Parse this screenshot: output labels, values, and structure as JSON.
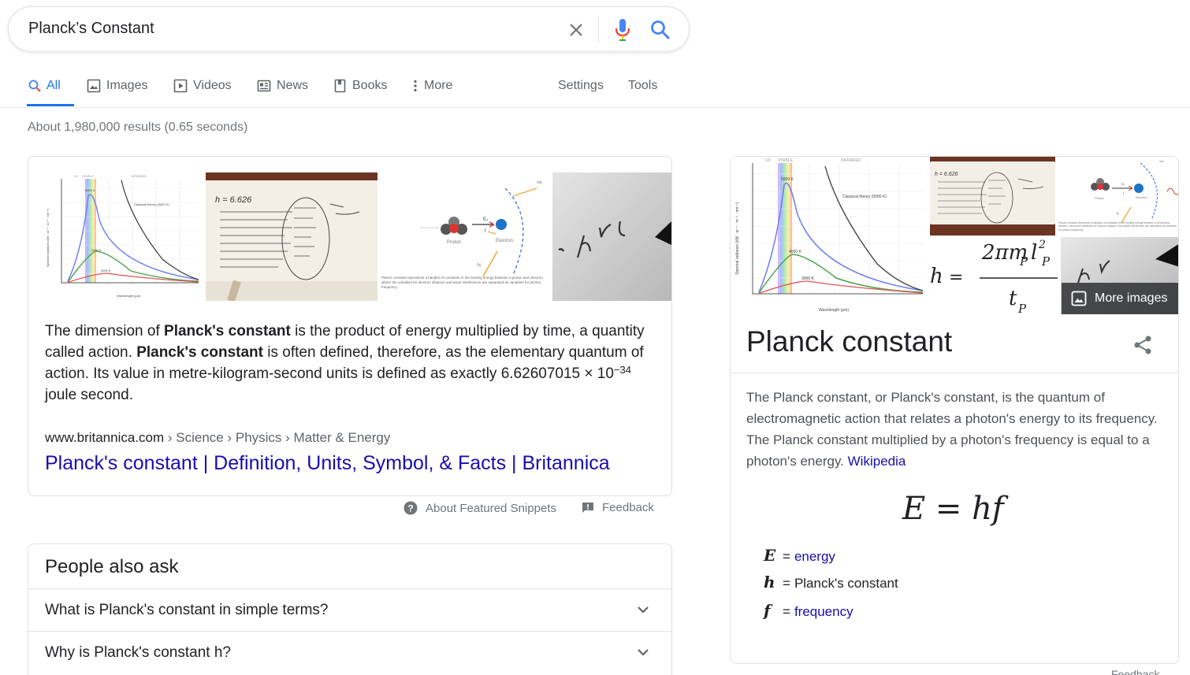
{
  "search": {
    "query": "Planck’s Constant",
    "icons": [
      "close-icon",
      "mic-icon",
      "search-icon"
    ]
  },
  "tabs": [
    {
      "label": "All",
      "icon": "search-icon",
      "active": true
    },
    {
      "label": "Images",
      "icon": "image-icon"
    },
    {
      "label": "Videos",
      "icon": "play-icon"
    },
    {
      "label": "News",
      "icon": "newspaper-icon"
    },
    {
      "label": "Books",
      "icon": "book-icon"
    },
    {
      "label": "More",
      "icon": "kebab-icon"
    }
  ],
  "tools": {
    "settings": "Settings",
    "tools": "Tools"
  },
  "stats": "About 1,980,000 results (0.65 seconds)",
  "snippet": {
    "thumb_text": {
      "curve_uv": "UV",
      "curve_visible": "VISIBLE",
      "curve_infrared": "INFRARED",
      "curve_classical": "Classical theory (5000 K)",
      "curve_5000": "5000 K",
      "curve_4000": "4000 K",
      "curve_3000": "3000 K",
      "curve_xlabel": "Wavelength (μm)",
      "curve_ylabel": "Spectral radiance (kW · sr⁻¹ · m⁻² · nm⁻¹)",
      "notes_h": "h = 6.626",
      "proton": "Proton",
      "electron": "Electron",
      "var": "var",
      "h": "h",
      "e2": "E₂",
      "f": "f",
      "diagram_caption": "Planck constant represents a handful of constants in the binding energy between a proton and electron, where the variables for electron distance and wave interference are separated as variables for photon frequency."
    },
    "text": {
      "p1": "The dimension of ",
      "b1": "Planck's constant",
      "p2": " is the product of energy multiplied by time, a quantity called action. ",
      "b2": "Planck's constant",
      "p3": " is often defined, therefore, as the elementary quantum of action. Its value in metre-kilogram-second units is defined as exactly 6.62607015 × 10",
      "exp": "−34",
      "p4": " joule second."
    },
    "cite_domain": "www.britannica.com",
    "cite_path": " › Science › Physics › Matter & Energy",
    "title": "Planck's constant | Definition, Units, Symbol, & Facts | Britannica",
    "about": "About Featured Snippets",
    "feedback": "Feedback"
  },
  "paa": {
    "title": "People also ask",
    "questions": [
      "What is Planck's constant in simple terms?",
      "Why is Planck's constant h?"
    ]
  },
  "knowledge_panel": {
    "more_images": "More images",
    "title": "Planck constant",
    "description": "The Planck constant, or Planck's constant, is the quantum of electromagnetic action that relates a photon's energy to its frequency. The Planck constant multiplied by a photon's frequency is equal to a photon's energy. ",
    "source": "Wikipedia",
    "formula": "E = hf",
    "image_formula": {
      "lhs": "h",
      "eq": "=",
      "num": "2πm",
      "sub": "P",
      "l": "l",
      "sup": "2",
      "den": "t"
    },
    "variables": [
      {
        "symbol": "E",
        "label": "energy",
        "link": true
      },
      {
        "symbol": "h",
        "label": "Planck's constant",
        "link": false
      },
      {
        "symbol": "f",
        "label": "frequency",
        "link": true
      }
    ],
    "feedback": "Feedback"
  },
  "colors": {
    "accent": "#1a73e8",
    "link": "#1a0dab",
    "muted": "#70757a"
  }
}
